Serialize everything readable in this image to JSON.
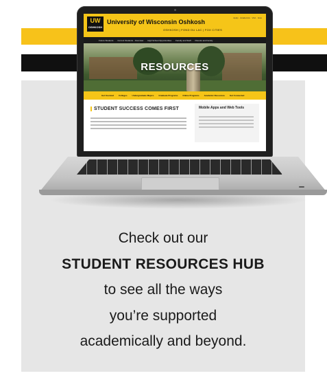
{
  "colors": {
    "gold": "#f7c21a",
    "black": "#101010",
    "panel": "#e6e6e6"
  },
  "laptop_screen": {
    "logo": "UW",
    "logo_sub": "OSHKOSH",
    "site_title": "University of Wisconsin Oshkosh",
    "tagline": "OSHKOSH | FOND DU LAC | FOX CITIES",
    "utility_nav": "Apply · Academics · Visit · Give",
    "main_nav": [
      "Future Students",
      "Current Students · Overview",
      "High School Opportunities",
      "Faculty and Staff",
      "Parents and Family"
    ],
    "hero_label": "RESOURCES",
    "sub_nav": [
      "Get Involved",
      "Colleges",
      "Undergraduate Majors",
      "Graduate Programs",
      "Online Programs",
      "Academic Resources",
      "Get Connected"
    ],
    "main_heading": "STUDENT SUCCESS COMES FIRST",
    "side_title": "Mobile Apps and Web Tools"
  },
  "cta": {
    "line1": "Check out our",
    "line2": "STUDENT RESOURCES HUB",
    "line3": "to see all the ways",
    "line4": "you’re supported",
    "line5": "academically and beyond."
  }
}
